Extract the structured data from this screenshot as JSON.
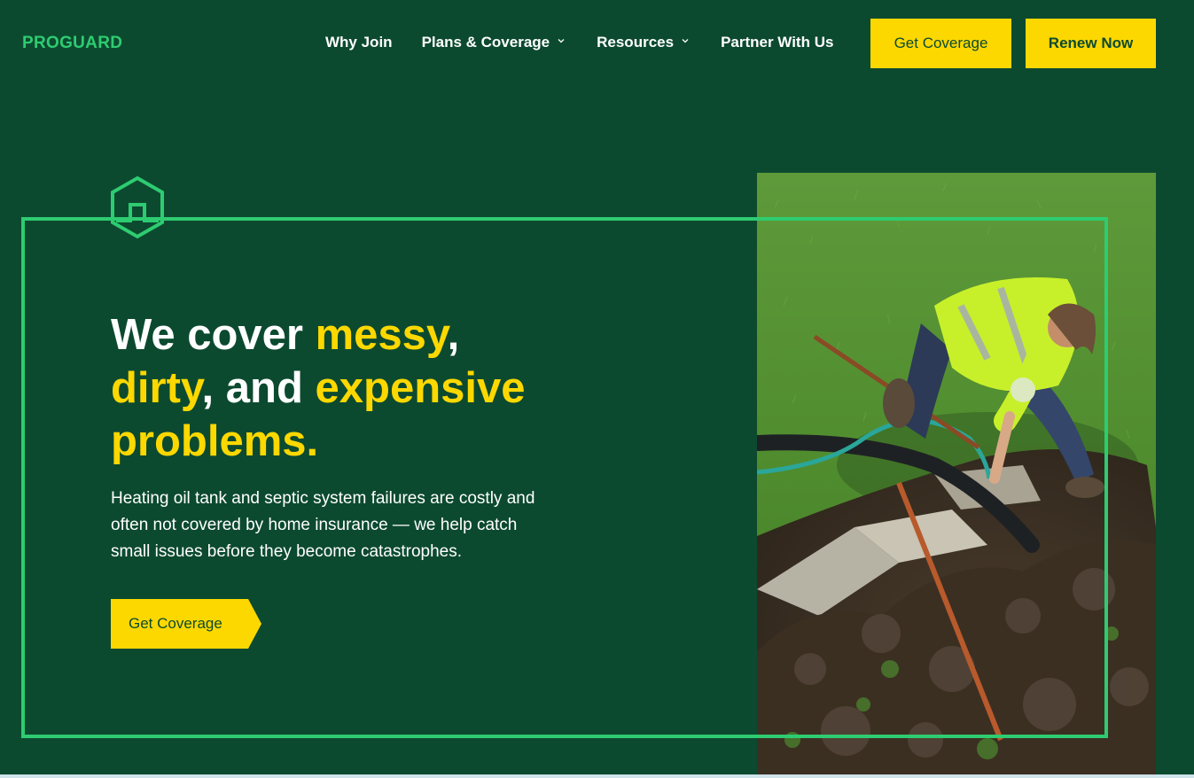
{
  "header": {
    "logo": "PROGUARD",
    "nav": [
      {
        "label": "Why Join",
        "dropdown": false
      },
      {
        "label": "Plans & Coverage",
        "dropdown": true
      },
      {
        "label": "Resources",
        "dropdown": true
      },
      {
        "label": "Partner With Us",
        "dropdown": false
      }
    ],
    "get_coverage_label": "Get Coverage",
    "renew_label": "Renew Now"
  },
  "hero": {
    "headline": {
      "w1": "We cover ",
      "w2": "messy",
      "w3": ",",
      "w4": "dirty",
      "w5": ", and ",
      "w6": "expensive",
      "w7": "problems."
    },
    "subtext": "Heating oil tank and septic system failures are costly and often not covered by home insurance — we help catch small issues before they become catastrophes.",
    "cta_label": "Get Coverage",
    "icon": "house-hexagon-icon",
    "image": "worker-septic-tank-photo"
  },
  "colors": {
    "background": "#0c4a30",
    "accent_green": "#2ecc71",
    "accent_yellow": "#fcd800",
    "text": "#ffffff"
  }
}
